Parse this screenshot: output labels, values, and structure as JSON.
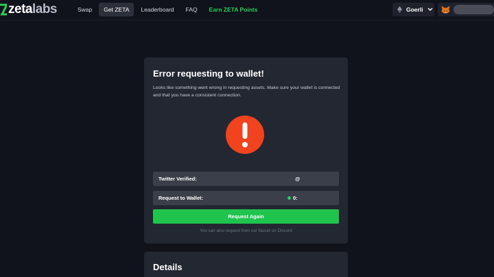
{
  "header": {
    "logo_main": "zeta",
    "logo_sub": "labs",
    "nav": [
      {
        "label": "Swap"
      },
      {
        "label": "Get ZETA"
      },
      {
        "label": "Leaderboard"
      },
      {
        "label": "FAQ"
      },
      {
        "label": "Earn ZETA Points"
      }
    ],
    "active_nav": "Get ZETA",
    "network_label": "Goerli"
  },
  "card": {
    "title": "Error requesting to wallet!",
    "description": "Looks like something went wrong in requesting assets. Make sure your wallet is connected and that you have a consistent connection.",
    "rows": [
      {
        "label": "Twitter Verified:",
        "value": "@"
      },
      {
        "label": "Request to Wallet:",
        "value": "0:"
      }
    ],
    "button_label": "Request Again",
    "footnote": "You can also request from our faucet on Discord"
  },
  "details": {
    "title": "Details"
  },
  "colors": {
    "accent_green": "#1fc44e",
    "error_red": "#f1431f",
    "background": "#10121c",
    "card": "#232731"
  }
}
